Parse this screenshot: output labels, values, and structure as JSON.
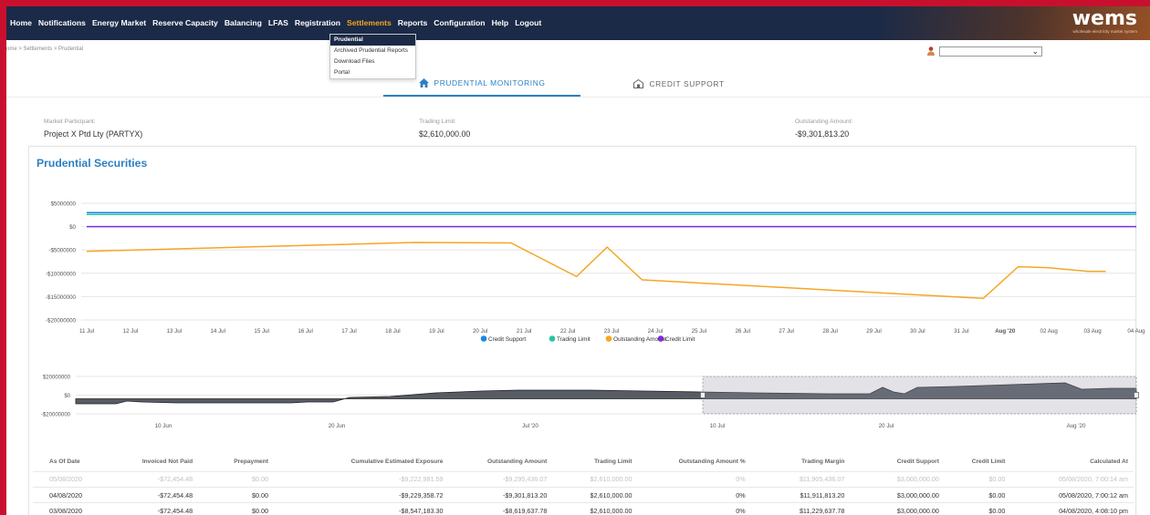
{
  "nav": {
    "items": [
      "Home",
      "Notifications",
      "Energy Market",
      "Reserve Capacity",
      "Balancing",
      "LFAS",
      "Registration",
      "Settlements",
      "Reports",
      "Configuration",
      "Help",
      "Logout"
    ],
    "active": "Settlements",
    "settlements_menu": [
      "Prudential",
      "Archived Prudential Reports",
      "Download Files",
      "Portal"
    ],
    "settlements_selected": "Prudential"
  },
  "logo": {
    "text": "wems",
    "tagline": "wholesale electricity market system"
  },
  "breadcrumb": "ome > Settlements > Prudential",
  "tabs": [
    {
      "label": "PRUDENTIAL MONITORING",
      "icon": "home-icon",
      "active": true
    },
    {
      "label": "CREDIT SUPPORT",
      "icon": "building-icon",
      "active": false
    }
  ],
  "summary": {
    "market_participant": {
      "label": "Market Participant:",
      "value": "Project X Ptd Lty (PARTYX)"
    },
    "trading_limit": {
      "label": "Trading Limit:",
      "value": "$2,610,000.00"
    },
    "outstanding_amount": {
      "label": "Outstanding Amount:",
      "value": "-$9,301,813.20"
    }
  },
  "panel_title": "Prudential Securities",
  "colors": {
    "accent": "#2b80c4",
    "nav_bg": "#1b2a47",
    "frame": "#c8102e",
    "credit_support": "#1e88e5",
    "trading_limit": "#26c6a0",
    "outstanding_amount": "#f5a623",
    "credit_limit": "#7b2cd6"
  },
  "chart_data": [
    {
      "type": "line",
      "title": "",
      "x": [
        "11 Jul",
        "12 Jul",
        "13 Jul",
        "14 Jul",
        "15 Jul",
        "16 Jul",
        "17 Jul",
        "18 Jul",
        "19 Jul",
        "20 Jul",
        "21 Jul",
        "22 Jul",
        "23 Jul",
        "24 Jul",
        "25 Jul",
        "26 Jul",
        "27 Jul",
        "28 Jul",
        "29 Jul",
        "30 Jul",
        "31 Jul",
        "Aug '20",
        "02 Aug",
        "03 Aug",
        "04 Aug"
      ],
      "yticks": [
        "$5000000",
        "$0",
        "-$5000000",
        "-$10000000",
        "-$15000000",
        "-$20000000"
      ],
      "ylim": [
        -20000000,
        5000000
      ],
      "legend": "bottom",
      "grid": true,
      "series": [
        {
          "name": "Credit Support",
          "color": "#1e88e5",
          "points": [
            [
              "11 Jul",
              3000000
            ],
            [
              "04 Aug",
              3000000
            ]
          ]
        },
        {
          "name": "Trading Limit",
          "color": "#26c6a0",
          "points": [
            [
              "11 Jul",
              2610000
            ],
            [
              "04 Aug",
              2610000
            ]
          ]
        },
        {
          "name": "Outstanding Amount",
          "color": "#f5a623",
          "points": [
            [
              "11 Jul",
              -5300000
            ],
            [
              "18.5 Jul",
              -3400000
            ],
            [
              "20.7 Jul",
              -3500000
            ],
            [
              "22.2 Jul",
              -10700000
            ],
            [
              "22.9 Jul",
              -4400000
            ],
            [
              "23.7 Jul",
              -11400000
            ],
            [
              "31.5 Jul",
              -15400000
            ],
            [
              "32.3 Jul",
              -8600000
            ],
            [
              "33 Jul",
              -8800000
            ],
            [
              "33.9 Jul",
              -9600000
            ],
            [
              "34.3 Jul",
              -9600000
            ]
          ]
        },
        {
          "name": "Credit Limit",
          "color": "#7b2cd6",
          "points": [
            [
              "11 Jul",
              0
            ],
            [
              "04 Aug",
              0
            ]
          ]
        }
      ]
    },
    {
      "type": "area",
      "title": "",
      "x": [
        "10 Jun",
        "20 Jun",
        "Jul '20",
        "10 Jul",
        "20 Jul",
        "Aug '20"
      ],
      "yticks": [
        "$20000000",
        "$0",
        "-$20000000"
      ],
      "ylim": [
        -20000000,
        20000000
      ],
      "navigator_range": [
        "10 Jul",
        "05 Aug"
      ]
    }
  ],
  "table": {
    "headers": [
      "As Of Date",
      "Invoiced Not Paid",
      "Prepayment",
      "Cumulative Estimated Exposure",
      "Outstanding Amount",
      "Trading Limit",
      "Outstanding Amount %",
      "Trading Margin",
      "Credit Support",
      "Credit Limit",
      "Calculated At"
    ],
    "rows": [
      [
        "05/08/2020",
        "-$72,454.48",
        "$0.00",
        "-$9,222,981.59",
        "-$9,295,436.07",
        "$2,610,000.00",
        "0%",
        "$11,905,436.07",
        "$3,000,000.00",
        "$0.00",
        "05/08/2020, 7:00:14 am"
      ],
      [
        "04/08/2020",
        "-$72,454.48",
        "$0.00",
        "-$9,229,358.72",
        "-$9,301,813.20",
        "$2,610,000.00",
        "0%",
        "$11,911,813.20",
        "$3,000,000.00",
        "$0.00",
        "05/08/2020, 7:00:12 am"
      ],
      [
        "03/08/2020",
        "-$72,454.48",
        "$0.00",
        "-$8,547,183.30",
        "-$8,619,637.78",
        "$2,610,000.00",
        "0%",
        "$11,229,637.78",
        "$3,000,000.00",
        "$0.00",
        "04/08/2020, 4:08:10 pm"
      ]
    ]
  }
}
